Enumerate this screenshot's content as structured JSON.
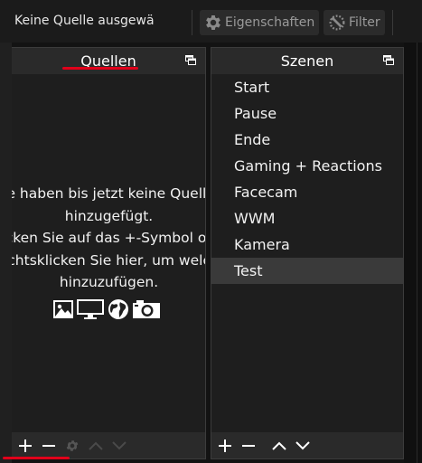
{
  "toolbar": {
    "source_label": "Keine Quelle ausgewä",
    "properties_label": "Eigenschaften",
    "filter_label": "Filter"
  },
  "sources_dock": {
    "title": "Quellen",
    "empty_lines": [
      "Sie haben bis jetzt keine Quellen",
      "hinzugefügt.",
      "Klicken Sie auf das +-Symbol oder",
      "Rechtsklicken Sie hier, um welche",
      "hinzuzufügen."
    ],
    "source_type_icons": [
      "image-icon",
      "display-icon",
      "browser-globe-icon",
      "camera-icon"
    ],
    "footer_icons": [
      "add-icon",
      "remove-icon",
      "gear-icon",
      "move-up-icon",
      "move-down-icon"
    ]
  },
  "scenes_dock": {
    "title": "Szenen",
    "items": [
      "Start",
      "Pause",
      "Ende",
      "Gaming + Reactions",
      "Facecam",
      "WWM",
      "Kamera",
      "Test"
    ],
    "selected_index": 7,
    "footer_icons": [
      "add-icon",
      "remove-icon",
      "move-up-icon",
      "move-down-icon"
    ]
  },
  "colors": {
    "annotation": "#e0001a",
    "dock_bg": "#1e1e1e",
    "header_bg": "#2a2a2a"
  }
}
